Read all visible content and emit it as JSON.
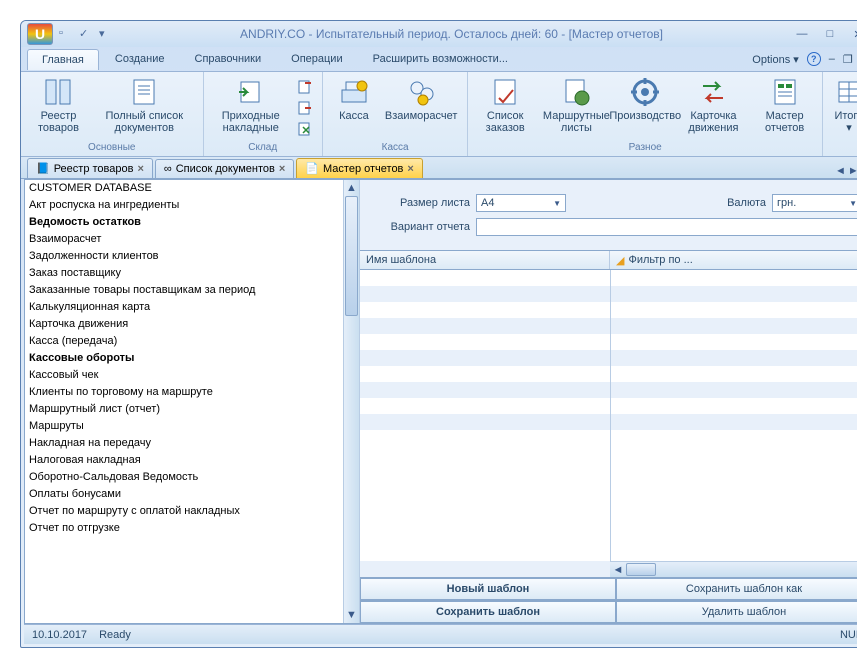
{
  "title": "ANDRIY.CO - Испытательный период. Осталось дней: 60 - [Мастер отчетов]",
  "menu": {
    "tabs": [
      "Главная",
      "Создание",
      "Справочники",
      "Операции",
      "Расширить возможности..."
    ],
    "options": "Options"
  },
  "ribbon": {
    "g1": {
      "items": [
        "Реестр товаров",
        "Полный список документов"
      ],
      "label": "Основные"
    },
    "g2": {
      "items": [
        "Приходные накладные"
      ],
      "label": "Склад"
    },
    "g3": {
      "items": [
        "Касса",
        "Взаиморасчет"
      ],
      "label": "Касса"
    },
    "g4": {
      "items": [
        "Список заказов",
        "Маршрутные листы",
        "Производство",
        "Карточка движения",
        "Мастер отчетов"
      ],
      "label": "Разное"
    },
    "g5": {
      "items": [
        "Итоги"
      ]
    }
  },
  "doctabs": [
    "Реестр товаров",
    "Список документов",
    "Мастер отчетов"
  ],
  "list": [
    {
      "t": "CUSTOMER DATABASE",
      "b": 0
    },
    {
      "t": "Акт роспуска на ингредиенты",
      "b": 0
    },
    {
      "t": "Ведомость остатков",
      "b": 1
    },
    {
      "t": "Взаиморасчет",
      "b": 0
    },
    {
      "t": "Задолженности клиентов",
      "b": 0
    },
    {
      "t": "Заказ поставщику",
      "b": 0
    },
    {
      "t": "Заказанные товары поставщикам за период",
      "b": 0
    },
    {
      "t": "Калькуляционная карта",
      "b": 0
    },
    {
      "t": "Карточка движения",
      "b": 0
    },
    {
      "t": "Касса (передача)",
      "b": 0
    },
    {
      "t": "Кассовые обороты",
      "b": 1
    },
    {
      "t": "Кассовый чек",
      "b": 0
    },
    {
      "t": "Клиенты по торговому на маршруте",
      "b": 0
    },
    {
      "t": "Маршрутный лист (отчет)",
      "b": 0
    },
    {
      "t": "Маршруты",
      "b": 0
    },
    {
      "t": "Накладная на передачу",
      "b": 0
    },
    {
      "t": "Налоговая накладная",
      "b": 0
    },
    {
      "t": "Оборотно-Сальдовая Ведомость",
      "b": 0
    },
    {
      "t": "Оплаты бонусами",
      "b": 0
    },
    {
      "t": "Отчет по маршруту с оплатой накладных",
      "b": 0
    },
    {
      "t": "Отчет по отгрузке",
      "b": 0
    }
  ],
  "form": {
    "paper_label": "Размер листа",
    "paper_value": "A4",
    "currency_label": "Валюта",
    "currency_value": "грн.",
    "variant_label": "Вариант отчета",
    "variant_value": "",
    "col1": "Имя шаблона",
    "col2": "Фильтр по ..."
  },
  "buttons": {
    "new": "Новый шаблон",
    "saveas": "Сохранить шаблон как",
    "save": "Сохранить шаблон",
    "del": "Удалить шаблон"
  },
  "status": {
    "date": "10.10.2017",
    "ready": "Ready",
    "num": "NUM"
  }
}
